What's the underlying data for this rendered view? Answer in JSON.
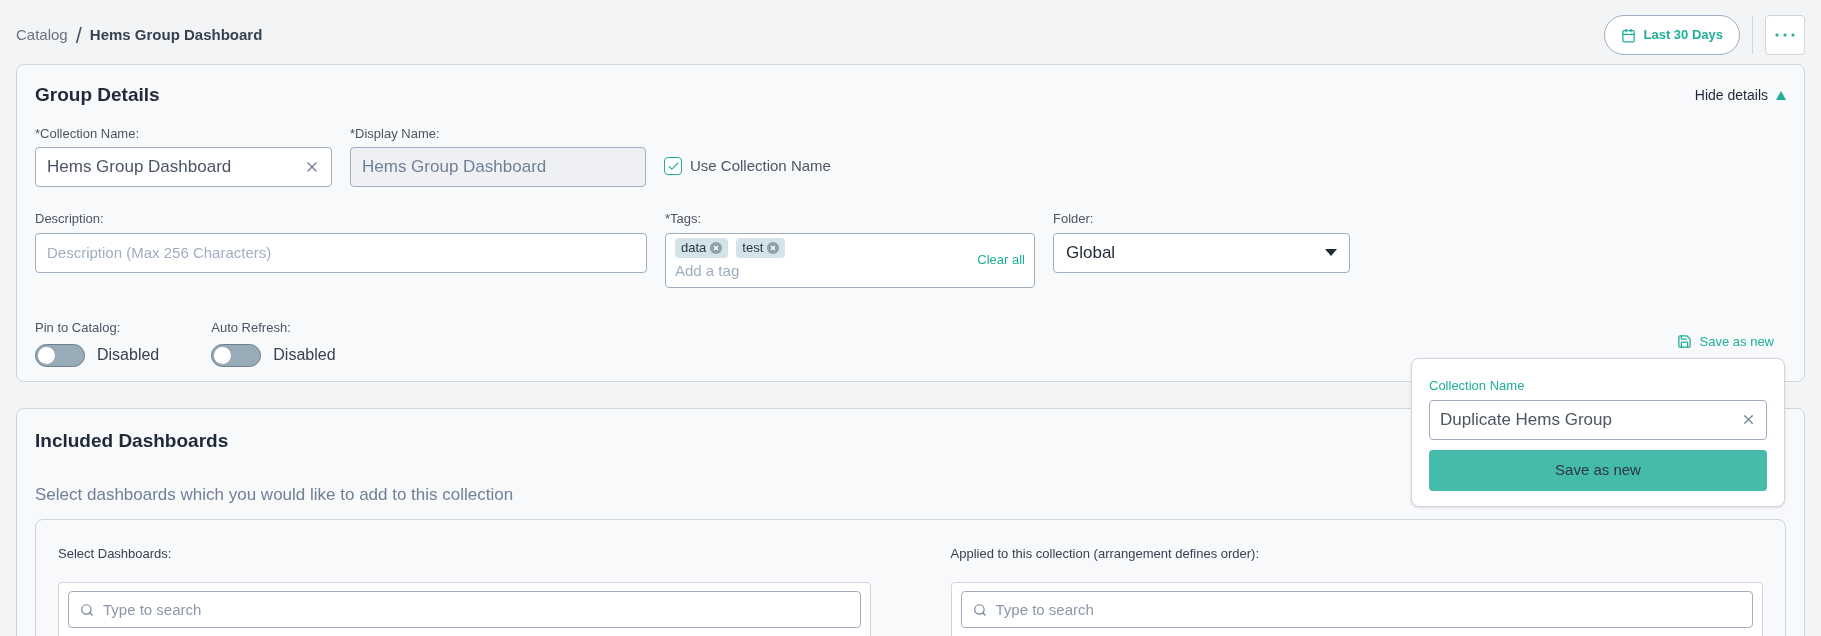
{
  "breadcrumb": {
    "parent": "Catalog",
    "separator": "/",
    "current": "Hems Group Dashboard"
  },
  "toolbar": {
    "date_range": "Last 30 Days"
  },
  "group_details": {
    "title": "Group Details",
    "toggle_link": "Hide details",
    "expanded": true,
    "collection_name": {
      "label": "*Collection Name:",
      "value": "Hems Group Dashboard"
    },
    "display_name": {
      "label": "*Display Name:",
      "value": "Hems Group Dashboard",
      "disabled": true
    },
    "use_collection_name": {
      "label": "Use Collection Name",
      "checked": true
    },
    "description": {
      "label": "Description:",
      "placeholder": "Description (Max 256 Characters)"
    },
    "tags": {
      "label": "*Tags:",
      "items": [
        "data",
        "test"
      ],
      "placeholder": "Add a tag",
      "clear": "Clear all"
    },
    "folder": {
      "label": "Folder:",
      "value": "Global"
    },
    "switches": [
      {
        "label": "Pin to Catalog:",
        "on": false,
        "state_text": "Disabled"
      },
      {
        "label": "Auto Refresh:",
        "on": false,
        "state_text": "Disabled"
      }
    ],
    "save_link": "Save as new"
  },
  "save_popover": {
    "label": "Collection Name",
    "value": "Duplicate Hems Group",
    "button": "Save as new"
  },
  "included": {
    "title": "Included Dashboards",
    "subtitle": "Select dashboards which you would like to add to this collection",
    "columns": [
      {
        "label": "Select Dashboards:",
        "placeholder": "Type to search"
      },
      {
        "label": "Applied to this collection (arrangement defines order):",
        "placeholder": "Type to search"
      }
    ]
  }
}
